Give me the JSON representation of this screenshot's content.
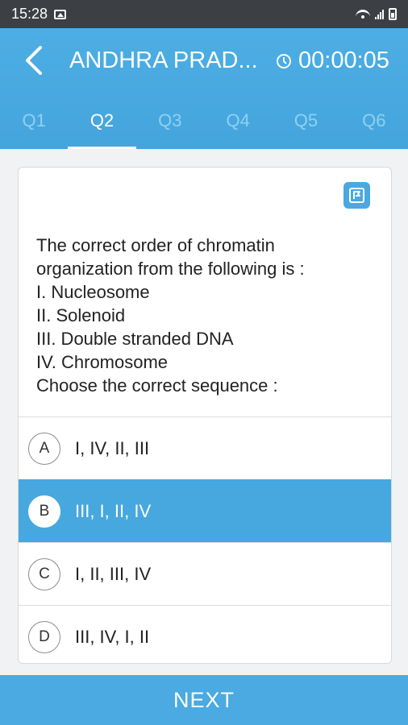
{
  "status_bar": {
    "time": "15:28"
  },
  "header": {
    "title": "ANDHRA PRAD...",
    "timer": "00:00:05",
    "tabs": [
      "Q1",
      "Q2",
      "Q3",
      "Q4",
      "Q5",
      "Q6"
    ],
    "active_tab": "Q2"
  },
  "question": {
    "lines": [
      "The correct order of chromatin",
      "organization from the following is :",
      "I. Nucleosome",
      "II. Solenoid",
      "III. Double stranded DNA",
      "IV. Chromosome",
      "Choose the correct sequence :"
    ]
  },
  "options": [
    {
      "letter": "A",
      "text": "I, IV, II, III",
      "selected": false
    },
    {
      "letter": "B",
      "text": "III, I, II, IV",
      "selected": true
    },
    {
      "letter": "C",
      "text": "I, II, III, IV",
      "selected": false
    },
    {
      "letter": "D",
      "text": "III, IV, I, II",
      "selected": false
    }
  ],
  "next_label": "NEXT",
  "colors": {
    "primary": "#4aaae1",
    "status_bar": "#3c3f44",
    "tab_inactive": "#8fd0f4"
  },
  "icons": [
    "gallery-icon",
    "wifi-icon",
    "signal-icon",
    "battery-icon",
    "back-icon",
    "clock-icon",
    "flag-icon"
  ]
}
